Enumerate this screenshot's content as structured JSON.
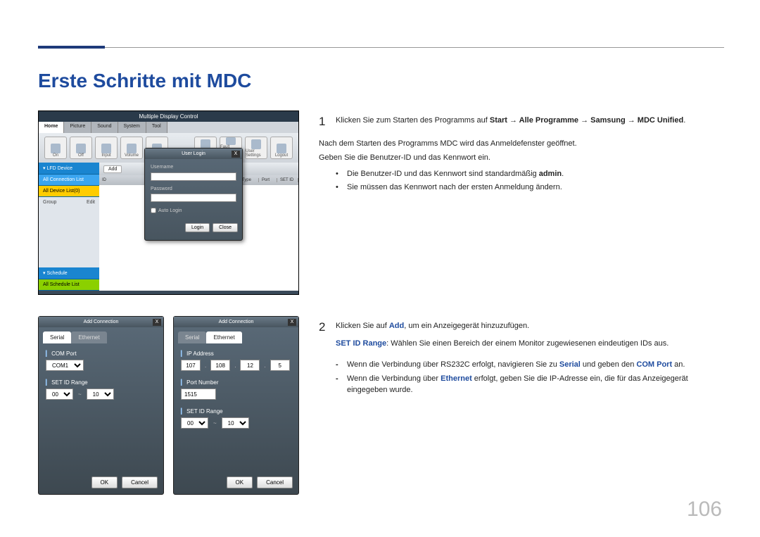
{
  "title": "Erste Schritte mit MDC",
  "page_number": "106",
  "mdc_window": {
    "title": "Multiple Display Control",
    "tabs": [
      "Home",
      "Picture",
      "Sound",
      "System",
      "Tool"
    ],
    "toolbar_right": [
      "Fault Device (0)",
      "Fault Device Alert",
      "User Settings",
      "Logout"
    ],
    "sidebar": {
      "lfd": "▾ LFD Device",
      "conn": "All Connection List",
      "all": "All Device List(0)",
      "group": "Group",
      "edit": "Edit",
      "sched": "▾ Schedule",
      "schedall": "All Schedule List"
    },
    "main_tools": {
      "add": "Add"
    },
    "main_header": [
      "ID",
      "",
      "Connection Type",
      "Port",
      "SET ID"
    ]
  },
  "login_dialog": {
    "title": "User Login",
    "username_label": "Username",
    "password_label": "Password",
    "autologin_label": "Auto Login",
    "login_btn": "Login",
    "close_btn": "Close"
  },
  "addconn_dialog": {
    "title": "Add Connection",
    "tabs": {
      "serial": "Serial",
      "ethernet": "Ethernet"
    },
    "comport_label": "COM Port",
    "comport_value": "COM1",
    "setid_label": "SET ID Range",
    "setid_from": "00",
    "setid_to": "10",
    "ip_label": "IP Address",
    "ip": [
      "107",
      "108",
      "12",
      "5"
    ],
    "port_label": "Port Number",
    "port_value": "1515",
    "ok": "OK",
    "cancel": "Cancel"
  },
  "step1": {
    "num": "1",
    "intro_pre": "Klicken Sie zum Starten des Programms auf ",
    "path1": "Start",
    "arrow": " → ",
    "path2": "Alle Programme",
    "path3": "Samsung",
    "path4": "MDC Unified",
    "period": ".",
    "after1": "Nach dem Starten des Programms MDC wird das Anmeldefenster geöffnet.",
    "after2": "Geben Sie die Benutzer-ID und das Kennwort ein.",
    "bullet1_pre": "Die Benutzer-ID und das Kennwort sind standardmäßig ",
    "bullet1_bold": "admin",
    "bullet1_post": ".",
    "bullet2": "Sie müssen das Kennwort nach der ersten Anmeldung ändern."
  },
  "step2": {
    "num": "2",
    "line1_pre": "Klicken Sie auf ",
    "line1_bold": "Add",
    "line1_post": ", um ein Anzeigegerät hinzuzufügen.",
    "line2_bold": "SET ID Range",
    "line2_post": ": Wählen Sie einen Bereich der einem Monitor zugewiesenen eindeutigen IDs aus.",
    "dash1_pre": "Wenn die Verbindung über RS232C erfolgt, navigieren Sie zu ",
    "dash1_bold1": "Serial",
    "dash1_mid": " und geben den ",
    "dash1_bold2": "COM Port",
    "dash1_post": " an.",
    "dash2_pre": "Wenn die Verbindung über ",
    "dash2_bold": "Ethernet",
    "dash2_post": " erfolgt, geben Sie die IP-Adresse ein, die für das Anzeigegerät eingegeben wurde."
  }
}
